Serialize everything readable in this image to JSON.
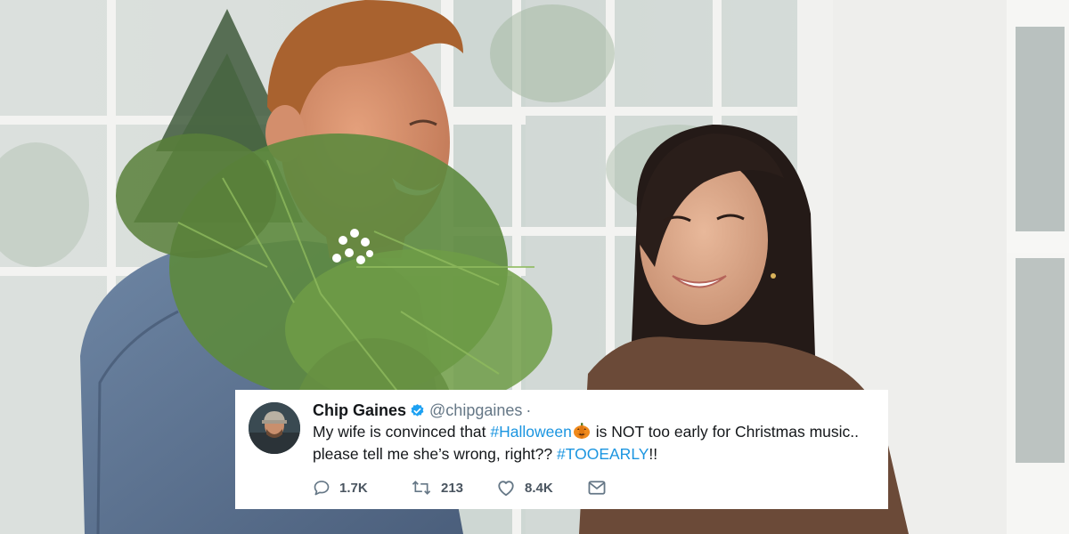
{
  "tweet": {
    "name": "Chip Gaines",
    "handle": "@chipgaines",
    "separator": "·",
    "text_part1": "My wife is convinced that ",
    "hashtag1": "#Halloween",
    "emoji_name": "jack-o-lantern-icon",
    "text_part2": " is NOT too early for Christmas music.. please tell me she’s wrong, right?? ",
    "hashtag2": "#TOOEARLY",
    "text_part3": "!!",
    "replies": "1.7K",
    "retweets": "213",
    "likes": "8.4K"
  },
  "colors": {
    "link": "#1b95e0",
    "verified": "#1da1f2",
    "muted": "#657786"
  },
  "icons": {
    "reply": "reply-icon",
    "retweet": "retweet-icon",
    "like": "heart-icon",
    "dm": "envelope-icon",
    "verified": "verified-badge-icon"
  }
}
